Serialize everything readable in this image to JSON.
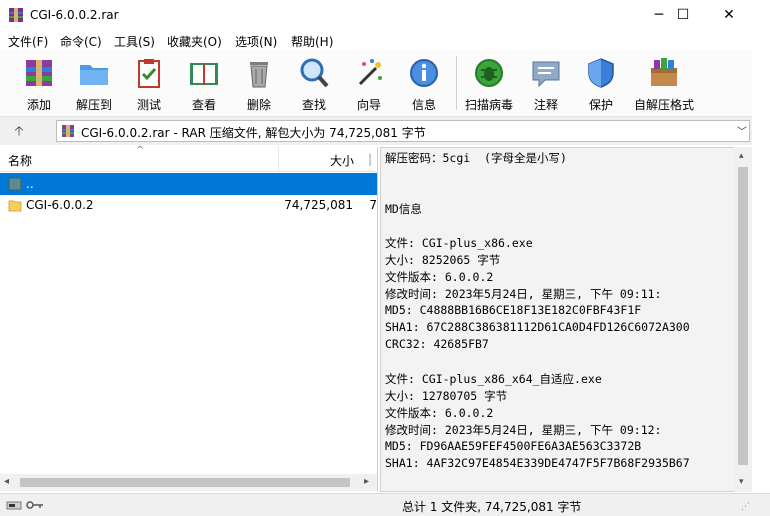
{
  "window": {
    "title": "CGI-6.0.0.2.rar",
    "minimize_glyph": "─",
    "maximize_glyph": "☐",
    "close_glyph": "✕"
  },
  "menu": [
    "文件(F)",
    "命令(C)",
    "工具(S)",
    "收藏夹(O)",
    "选项(N)",
    "帮助(H)"
  ],
  "toolbar": [
    {
      "label": "添加",
      "icon": "add-archive-icon"
    },
    {
      "label": "解压到",
      "icon": "extract-folder-icon"
    },
    {
      "label": "测试",
      "icon": "test-clipboard-icon"
    },
    {
      "label": "查看",
      "icon": "view-book-icon"
    },
    {
      "label": "删除",
      "icon": "trash-icon"
    },
    {
      "label": "查找",
      "icon": "magnifier-icon"
    },
    {
      "label": "向导",
      "icon": "wizard-wand-icon"
    },
    {
      "label": "信息",
      "icon": "info-icon"
    },
    {
      "label": "扫描病毒",
      "icon": "virus-scan-icon"
    },
    {
      "label": "注释",
      "icon": "comment-icon"
    },
    {
      "label": "保护",
      "icon": "shield-icon"
    },
    {
      "label": "自解压格式",
      "icon": "sfx-box-icon"
    }
  ],
  "address": {
    "up_glyph": "🡡",
    "path": "CGI-6.0.0.2.rar - RAR 压缩文件, 解包大小为 74,725,081 字节",
    "dropdown_glyph": "﹀"
  },
  "file_list": {
    "headers": {
      "name": "名称",
      "size": "大小",
      "extra": "|"
    },
    "sort_glyph": "^",
    "rows": [
      {
        "name": "..",
        "size": "",
        "extra": "",
        "selected": true
      },
      {
        "name": "CGI-6.0.0.2",
        "size": "74,725,081",
        "extra": "7",
        "selected": false
      }
    ]
  },
  "comment_lines": [
    "解压密码：5cgi  (字母全是小写)",
    "",
    "",
    "MD信息",
    "",
    "文件: CGI-plus_x86.exe",
    "大小: 8252065 字节",
    "文件版本: 6.0.0.2",
    "修改时间: 2023年5月24日, 星期三, 下午 09:11:",
    "MD5: C4888BB16B6CE18F13E182C0FBF43F1F",
    "SHA1: 67C288C386381112D61CA0D4FD126C6072A300",
    "CRC32: 42685FB7",
    "",
    "文件: CGI-plus_x86_x64_自适应.exe",
    "大小: 12780705 字节",
    "文件版本: 6.0.0.2",
    "修改时间: 2023年5月24日, 星期三, 下午 09:12:",
    "MD5: FD96AAE59FEF4500FE6A3AE563C3372B",
    "SHA1: 4AF32C97E4854E339DE4747F5F7B68F2935B67"
  ],
  "status": {
    "text": "总计 1 文件夹, 74,725,081 字节"
  },
  "colors": {
    "selection": "#0078d7",
    "comment_bg": "#f3f3f3"
  }
}
